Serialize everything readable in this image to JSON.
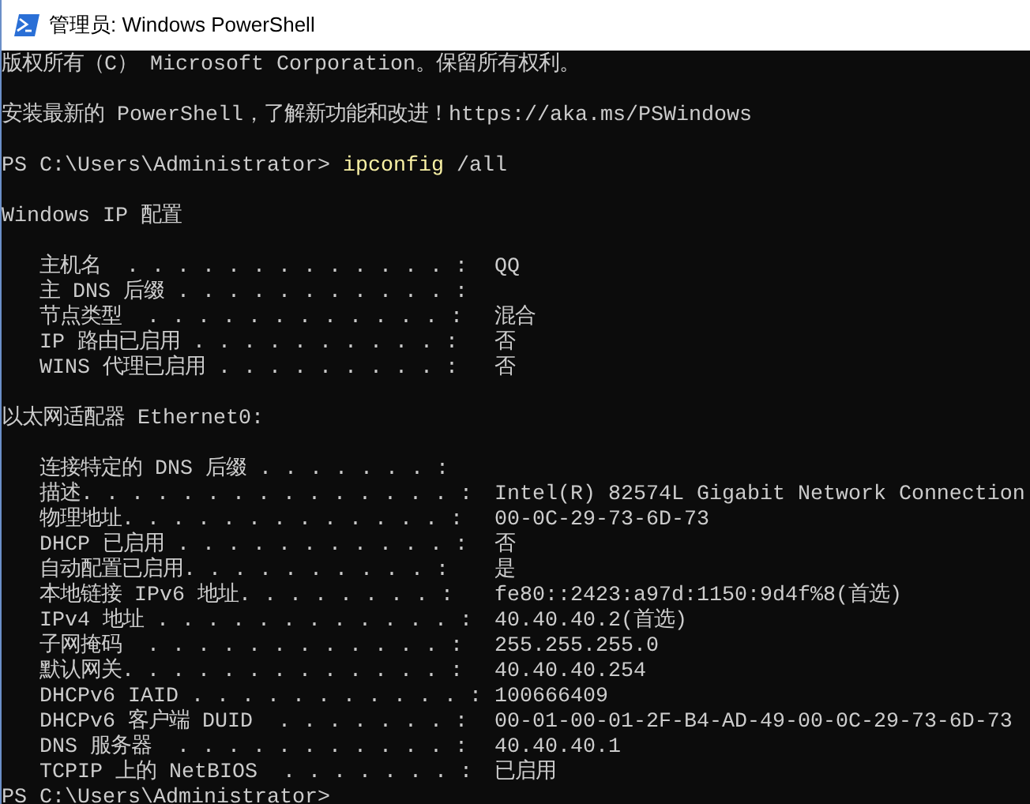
{
  "window": {
    "title": "管理员: Windows PowerShell"
  },
  "console": [
    {
      "kind": "text",
      "text": "版权所有（C） Microsoft Corporation。保留所有权利。"
    },
    {
      "kind": "blank"
    },
    {
      "kind": "text",
      "text": "安装最新的 PowerShell，了解新功能和改进！https://aka.ms/PSWindows"
    },
    {
      "kind": "blank"
    },
    {
      "kind": "prompt",
      "prompt": "PS C:\\Users\\Administrator>",
      "command": "ipconfig",
      "args": "/all"
    },
    {
      "kind": "blank"
    },
    {
      "kind": "text",
      "text": "Windows IP 配置"
    },
    {
      "kind": "blank"
    },
    {
      "kind": "field",
      "label": "主机名  . . . . . . . . . . . . . :",
      "value": "QQ"
    },
    {
      "kind": "field",
      "label": "主 DNS 后缀 . . . . . . . . . . . :"
    },
    {
      "kind": "field",
      "label": "节点类型  . . . . . . . . . . . . :",
      "value": "混合"
    },
    {
      "kind": "field",
      "label": "IP 路由已启用 . . . . . . . . . . :",
      "value": "否"
    },
    {
      "kind": "field",
      "label": "WINS 代理已启用 . . . . . . . . . :",
      "value": "否"
    },
    {
      "kind": "blank"
    },
    {
      "kind": "text",
      "text": "以太网适配器 Ethernet0:"
    },
    {
      "kind": "blank"
    },
    {
      "kind": "field",
      "label": "连接特定的 DNS 后缀 . . . . . . . :"
    },
    {
      "kind": "field",
      "label": "描述. . . . . . . . . . . . . . . :",
      "value": "Intel(R) 82574L Gigabit Network Connection"
    },
    {
      "kind": "field",
      "label": "物理地址. . . . . . . . . . . . . :",
      "value": "00-0C-29-73-6D-73"
    },
    {
      "kind": "field",
      "label": "DHCP 已启用 . . . . . . . . . . . :",
      "value": "否"
    },
    {
      "kind": "field",
      "label": "自动配置已启用. . . . . . . . . . :",
      "value": "是"
    },
    {
      "kind": "field",
      "label": "本地链接 IPv6 地址. . . . . . . . :",
      "value": "fe80::2423:a97d:1150:9d4f%8(首选)"
    },
    {
      "kind": "field",
      "label": "IPv4 地址 . . . . . . . . . . . . :",
      "value": "40.40.40.2(首选)"
    },
    {
      "kind": "field",
      "label": "子网掩码  . . . . . . . . . . . . :",
      "value": "255.255.255.0"
    },
    {
      "kind": "field",
      "label": "默认网关. . . . . . . . . . . . . :",
      "value": "40.40.40.254"
    },
    {
      "kind": "field",
      "label": "DHCPv6 IAID . . . . . . . . . . . :",
      "value": "100666409"
    },
    {
      "kind": "field",
      "label": "DHCPv6 客户端 DUID  . . . . . . . :",
      "value": "00-01-00-01-2F-B4-AD-49-00-0C-29-73-6D-73"
    },
    {
      "kind": "field",
      "label": "DNS 服务器  . . . . . . . . . . . :",
      "value": "40.40.40.1"
    },
    {
      "kind": "field",
      "label": "TCPIP 上的 NetBIOS  . . . . . . . :",
      "value": "已启用"
    },
    {
      "kind": "prompt",
      "prompt": "PS C:\\Users\\Administrator>"
    }
  ]
}
